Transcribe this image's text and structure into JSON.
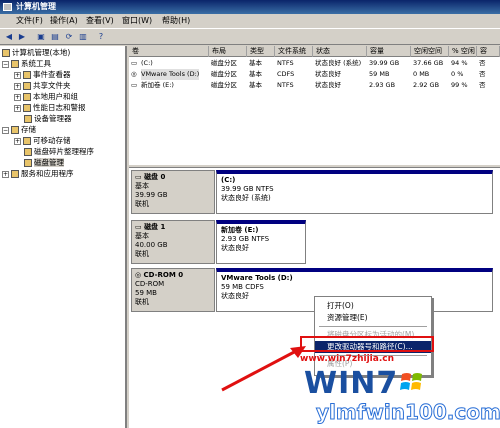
{
  "window": {
    "title": "计算机管理"
  },
  "menu": {
    "items": [
      "文件(F)",
      "操作(A)",
      "查看(V)",
      "窗口(W)",
      "帮助(H)"
    ]
  },
  "toolbar": {
    "icons": [
      "back-icon",
      "forward-icon",
      "up-icon",
      "properties-icon",
      "refresh-icon",
      "export-icon",
      "help-icon"
    ]
  },
  "tree": {
    "root": "计算机管理(本地)",
    "system_tools": "系统工具",
    "event_viewer": "事件查看器",
    "shared_folders": "共享文件夹",
    "local_users": "本地用户和组",
    "perf_logs": "性能日志和警报",
    "device_manager": "设备管理器",
    "storage": "存储",
    "removable": "可移动存储",
    "defrag": "磁盘碎片整理程序",
    "disk_mgmt": "磁盘管理",
    "services": "服务和应用程序"
  },
  "volumes": {
    "headers": [
      "卷",
      "布局",
      "类型",
      "文件系统",
      "状态",
      "容量",
      "空闲空间",
      "% 空闲",
      "容"
    ],
    "rows": [
      {
        "vol": "(C:)",
        "layout": "磁盘分区",
        "type": "基本",
        "fs": "NTFS",
        "status": "状态良好 (系统)",
        "capacity": "39.99 GB",
        "free": "37.66 GB",
        "pct": "94 %",
        "ft": "否"
      },
      {
        "vol": "VMware Tools (D:)",
        "layout": "磁盘分区",
        "type": "基本",
        "fs": "CDFS",
        "status": "状态良好",
        "capacity": "59 MB",
        "free": "0 MB",
        "pct": "0 %",
        "ft": "否"
      },
      {
        "vol": "新加卷 (E:)",
        "layout": "磁盘分区",
        "type": "基本",
        "fs": "NTFS",
        "status": "状态良好",
        "capacity": "2.93 GB",
        "free": "2.92 GB",
        "pct": "99 %",
        "ft": "否"
      }
    ]
  },
  "disks": [
    {
      "name": "磁盘 0",
      "kind": "基本",
      "size": "39.99 GB",
      "state": "联机",
      "part_name": "(C:)",
      "part_size": "39.99 GB NTFS",
      "part_status": "状态良好 (系统)"
    },
    {
      "name": "磁盘 1",
      "kind": "基本",
      "size": "40.00 GB",
      "state": "联机",
      "part_name": "新加卷 (E:)",
      "part_size": "2.93 GB NTFS",
      "part_status": "状态良好"
    },
    {
      "name": "CD-ROM 0",
      "kind": "CD-ROM",
      "size": "59 MB",
      "state": "联机",
      "part_name": "VMware Tools (D:)",
      "part_size": "59 MB CDFS",
      "part_status": "状态良好"
    }
  ],
  "context_menu": {
    "open": "打开(O)",
    "explore": "资源管理(E)",
    "mark_active": "将磁盘分区标为活动的(M)",
    "change_letter": "更改驱动器号和路径(C)...",
    "properties": "属性(P)",
    "help": "帮助(H)"
  },
  "watermark": {
    "url": "www.win7zhijia.cn",
    "logo_text": "WIN7",
    "site": "ylmfwin100.com"
  },
  "colors": {
    "title_bar": "#0a246a",
    "partition_bar": "#000080",
    "highlight": "#0a246a",
    "red": "#e01010"
  }
}
